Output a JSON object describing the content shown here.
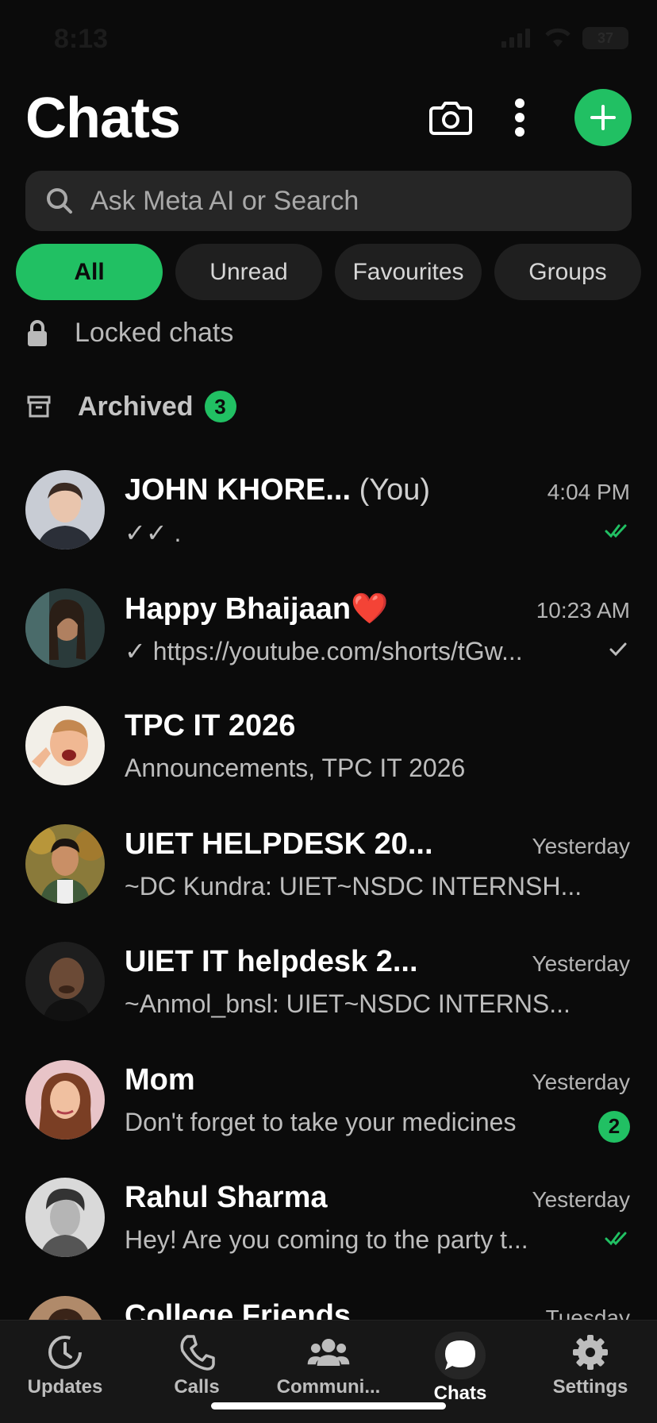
{
  "status_bar": {
    "time": "8:13",
    "battery": "37"
  },
  "header": {
    "title": "Chats"
  },
  "search": {
    "placeholder": "Ask Meta AI or Search"
  },
  "filters": [
    {
      "label": "All",
      "active": true
    },
    {
      "label": "Unread",
      "active": false
    },
    {
      "label": "Favourites",
      "active": false
    },
    {
      "label": "Groups",
      "active": false
    }
  ],
  "locked": {
    "label": "Locked chats"
  },
  "archived": {
    "label": "Archived",
    "count": "3"
  },
  "chats": [
    {
      "name": "JOHN KHORE...",
      "suffix": "(You)",
      "time": "4:04 PM",
      "preview": "✓✓ .",
      "status": "double-check-green"
    },
    {
      "name": "Happy Bhaijaan",
      "emoji": "❤️",
      "time": "10:23 AM",
      "preview": "✓ https://youtube.com/shorts/tGw...",
      "status": "single-check"
    },
    {
      "name": "TPC IT 2026",
      "time": "",
      "preview": "Announcements, TPC IT 2026",
      "status": ""
    },
    {
      "name": "UIET HELPDESK 20...",
      "time": "Yesterday",
      "preview": "~DC Kundra: UIET~NSDC INTERNSH...",
      "status": ""
    },
    {
      "name": "UIET IT helpdesk 2...",
      "time": "Yesterday",
      "preview": "~Anmol_bnsl: UIET~NSDC INTERNS...",
      "status": ""
    },
    {
      "name": "Mom",
      "time": "Yesterday",
      "preview": "Don't forget to take your medicines",
      "unread": "2"
    },
    {
      "name": "Rahul Sharma",
      "time": "Yesterday",
      "preview": "Hey! Are you coming to the party t...",
      "status": "double-check-green"
    },
    {
      "name": "College Friends",
      "time": "Tuesday",
      "preview": "",
      "status": ""
    }
  ],
  "nav": [
    {
      "label": "Updates",
      "icon": "updates-icon"
    },
    {
      "label": "Calls",
      "icon": "phone-icon"
    },
    {
      "label": "Communi...",
      "icon": "communities-icon"
    },
    {
      "label": "Chats",
      "icon": "chat-bubble-icon",
      "active": true
    },
    {
      "label": "Settings",
      "icon": "gear-icon"
    }
  ],
  "colors": {
    "accent": "#21c063",
    "background": "#0b0b0b"
  }
}
